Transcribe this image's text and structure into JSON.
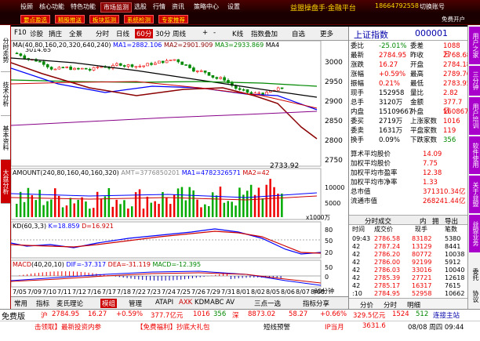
{
  "menu": {
    "items": [
      "投顾",
      "核心功能",
      "特色功能",
      "市场监测",
      "选股",
      "行情",
      "资讯",
      "策略中心",
      "设置"
    ],
    "active": 3,
    "title": "益盟操盘手·金融平台",
    "phone": "18664792558",
    "account": "切换账号",
    "brand": "免费开户",
    "sub": "资讯"
  },
  "toolbar2": {
    "buttons": [
      "要点盈选",
      "精股推送",
      "板块监测",
      "系统检测",
      "专家推荐"
    ]
  },
  "leftstrip": {
    "tabs": [
      "分时走势",
      "技术分析",
      "基本资料",
      "大盘分析"
    ]
  },
  "rightstrip": {
    "tabs": [
      "用户之家",
      "三分钟",
      "用户培训",
      "软件使用",
      "关于益盟",
      "益盟业务"
    ],
    "bottom": [
      "委托",
      "协议"
    ]
  },
  "chartbar": {
    "items": [
      "F10",
      "诊股",
      "摘庄",
      "全景",
      "分时",
      "日线",
      "60分",
      "30分",
      "周线",
      "+",
      "-",
      "K线",
      "指数叠加",
      "自选",
      "更多"
    ],
    "active": 6
  },
  "kline": {
    "ma_label": "MA",
    "params": "(40,80,160,20,320,640,240)",
    "ma1": "MA1=2882.106",
    "ma2": "MA2=2901.909",
    "ma3": "MA3=2933.869",
    "ma4": "MA4",
    "high_label": "3014.65",
    "low_label": "2733.92",
    "yticks": [
      "3000",
      "2950",
      "2900",
      "2850",
      "2800",
      "2750"
    ]
  },
  "amount": {
    "label": "AMOUNT",
    "params": "(240,80,160,40,160,320)",
    "amt": "AMT=3776850201",
    "ma1": "MA1=4782326571",
    "ma2": "MA2=42",
    "yticks": [
      "10000",
      "5000"
    ],
    "unit": "x1000万"
  },
  "kd": {
    "label": "KD",
    "params": "(60,3,3)",
    "k": "K=18.859",
    "d": "D=16.921",
    "yticks": [
      "80",
      "50",
      "20"
    ]
  },
  "macd": {
    "label": "MACD",
    "params": "(40,20,10)",
    "dif": "DIF=-37.317",
    "dea": "DEA=-31.119",
    "macd": "MACD=-12.395",
    "yticks": [
      "50",
      "0"
    ]
  },
  "xaxis": [
    "7/05",
    "7/09",
    "7/10",
    "7/11",
    "7/12",
    "7/16",
    "7/17",
    "7/18",
    "7/22",
    "7/23",
    "7/24",
    "7/25",
    "7/26",
    "7/29",
    "7/31",
    "8/01",
    "8/02",
    "8/05",
    "8/06",
    "8/07",
    "8/08"
  ],
  "bottomtabs": {
    "items": [
      "常用",
      "指标",
      "麦氏理论",
      "模组",
      "管理",
      "ATAPI",
      "AXK",
      "KDM",
      "ABC",
      "AV",
      "三点一选",
      "指标分享"
    ],
    "extra": "60分钟"
  },
  "quote": {
    "title": "上证指数",
    "code": "000001",
    "rows": [
      [
        "委比",
        "-25.01%",
        "委差",
        "1088万"
      ],
      [
        "最新",
        "2784.95",
        "昨收",
        "2768.68"
      ],
      [
        "涨跌",
        "16.27",
        "开盘",
        "2784.18"
      ],
      [
        "涨幅",
        "+0.59%",
        "最高",
        "2789.76"
      ],
      [
        "振幅",
        "0.21%",
        "最低",
        "2783.95"
      ],
      [
        "现手",
        "152958",
        "量比",
        "2.82"
      ],
      [
        "总手",
        "3120万",
        "金额",
        "377.7亿"
      ],
      [
        "内盘",
        "15109667",
        "外盘",
        "16086704"
      ],
      [
        "委买",
        "2719万",
        "上涨家数",
        "1016"
      ],
      [
        "委卖",
        "1631万",
        "平盘家数",
        "119"
      ],
      [
        "换手",
        "0.09%",
        "下跌家数",
        "356"
      ]
    ],
    "stats": [
      [
        "算术平均股价",
        "14.09"
      ],
      [
        "加权平均股价",
        "7.75"
      ],
      [
        "加权平均市盈率",
        "12.38"
      ],
      [
        "加权平均市净率",
        "1.33"
      ],
      [
        "总市值",
        "371310.34亿"
      ],
      [
        "流通市值",
        "268241.44亿"
      ]
    ],
    "tabs": [
      "分时成交",
      "内",
      "拥",
      "导出"
    ],
    "tick_header": [
      "时间",
      "成交价",
      "现手",
      "笔数"
    ],
    "ticks": [
      [
        "09:43",
        "2786.58",
        "83182",
        "5380"
      ],
      [
        "42",
        "2787.24",
        "13129",
        "8441"
      ],
      [
        "42",
        "2786.20",
        "80772",
        "10038"
      ],
      [
        "42",
        "2786.00",
        "92199",
        "5912"
      ],
      [
        "42",
        "2786.03",
        "33016",
        "10040"
      ],
      [
        "42",
        "2785.39",
        "27721",
        "12618"
      ],
      [
        "42",
        "2785.17",
        "16317",
        "7615"
      ],
      [
        ":10",
        "2784.95",
        "52958",
        "10662"
      ]
    ],
    "bottom": [
      "分价",
      "分时",
      "明细"
    ]
  },
  "status": {
    "label": "免费版",
    "sh_name": "沪",
    "sh_price": "2784.95",
    "sh_chg": "16.27",
    "sh_pct": "+0.59%",
    "sh_amt": "377.7亿元",
    "up": "1016",
    "down": "356",
    "sz_name": "深",
    "sz_price": "8873.02",
    "sz_chg": "58.27",
    "sz_pct": "+0.66%",
    "sz_amt": "329.5亿元",
    "sz_up": "1524",
    "sz_down": "512",
    "connected": "连接主站"
  },
  "status2": {
    "news": "击领取】最新投资内参",
    "ad": "【免费福利】抄底大礼包",
    "warn": "短线预警",
    "ipo": "IP当月",
    "price": "3631.6",
    "time": "08/08 周四 09:44"
  },
  "colors": {
    "accent": "#cc0000",
    "up": "#e00000",
    "down": "#008800",
    "ma1": "#0000ff",
    "ma2": "#8b0000",
    "ma3": "#008000",
    "ma4": "#000000"
  }
}
